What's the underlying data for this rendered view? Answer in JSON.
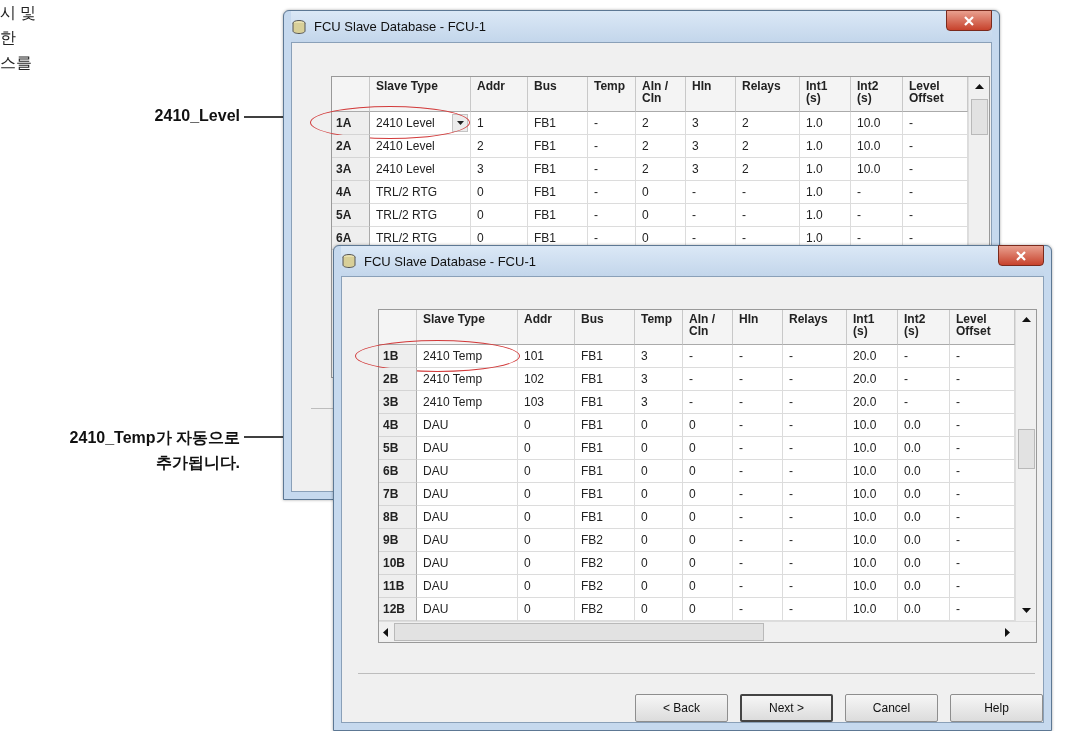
{
  "side_text": {
    "lines": [
      "시 및",
      "한",
      "스를"
    ]
  },
  "callouts": [
    {
      "lines": [
        "2410_Level"
      ]
    },
    {
      "lines": [
        "2410_Temp가 자동으로",
        "추가됩니다."
      ]
    }
  ],
  "windows": [
    {
      "title": "FCU Slave Database - FCU-1",
      "columns": [
        "",
        "Slave Type",
        "Addr",
        "Bus",
        "Temp",
        "AIn /\nCIn",
        "HIn",
        "Relays",
        "Int1\n(s)",
        "Int2\n(s)",
        "Level\nOffset"
      ],
      "rows": [
        {
          "circled": true,
          "dropdown": true,
          "cells": [
            "1A",
            "2410 Level",
            "1",
            "FB1",
            "-",
            "2",
            "3",
            "2",
            "1.0",
            "10.0",
            "-"
          ]
        },
        {
          "circled": false,
          "dropdown": false,
          "cells": [
            "2A",
            "2410 Level",
            "2",
            "FB1",
            "-",
            "2",
            "3",
            "2",
            "1.0",
            "10.0",
            "-"
          ]
        },
        {
          "circled": false,
          "dropdown": false,
          "cells": [
            "3A",
            "2410 Level",
            "3",
            "FB1",
            "-",
            "2",
            "3",
            "2",
            "1.0",
            "10.0",
            "-"
          ]
        },
        {
          "circled": false,
          "dropdown": false,
          "cells": [
            "4A",
            "TRL/2 RTG",
            "0",
            "FB1",
            "-",
            "0",
            "-",
            "-",
            "1.0",
            "-",
            "-"
          ]
        },
        {
          "circled": false,
          "dropdown": false,
          "cells": [
            "5A",
            "TRL/2 RTG",
            "0",
            "FB1",
            "-",
            "0",
            "-",
            "-",
            "1.0",
            "-",
            "-"
          ]
        },
        {
          "circled": false,
          "dropdown": false,
          "cells": [
            "6A",
            "TRL/2 RTG",
            "0",
            "FB1",
            "-",
            "0",
            "-",
            "-",
            "1.0",
            "-",
            "-"
          ]
        }
      ]
    },
    {
      "title": "FCU Slave Database - FCU-1",
      "columns": [
        "",
        "Slave Type",
        "Addr",
        "Bus",
        "Temp",
        "AIn /\nCIn",
        "HIn",
        "Relays",
        "Int1\n(s)",
        "Int2\n(s)",
        "Level\nOffset"
      ],
      "rows": [
        {
          "circled": true,
          "dropdown": false,
          "cells": [
            "1B",
            "2410 Temp",
            "101",
            "FB1",
            "3",
            "-",
            "-",
            "-",
            "20.0",
            "-",
            "-"
          ]
        },
        {
          "circled": false,
          "dropdown": false,
          "cells": [
            "2B",
            "2410 Temp",
            "102",
            "FB1",
            "3",
            "-",
            "-",
            "-",
            "20.0",
            "-",
            "-"
          ]
        },
        {
          "circled": false,
          "dropdown": false,
          "cells": [
            "3B",
            "2410 Temp",
            "103",
            "FB1",
            "3",
            "-",
            "-",
            "-",
            "20.0",
            "-",
            "-"
          ]
        },
        {
          "circled": false,
          "dropdown": false,
          "cells": [
            "4B",
            "DAU",
            "0",
            "FB1",
            "0",
            "0",
            "-",
            "-",
            "10.0",
            "0.0",
            "-"
          ]
        },
        {
          "circled": false,
          "dropdown": false,
          "cells": [
            "5B",
            "DAU",
            "0",
            "FB1",
            "0",
            "0",
            "-",
            "-",
            "10.0",
            "0.0",
            "-"
          ]
        },
        {
          "circled": false,
          "dropdown": false,
          "cells": [
            "6B",
            "DAU",
            "0",
            "FB1",
            "0",
            "0",
            "-",
            "-",
            "10.0",
            "0.0",
            "-"
          ]
        },
        {
          "circled": false,
          "dropdown": false,
          "cells": [
            "7B",
            "DAU",
            "0",
            "FB1",
            "0",
            "0",
            "-",
            "-",
            "10.0",
            "0.0",
            "-"
          ]
        },
        {
          "circled": false,
          "dropdown": false,
          "cells": [
            "8B",
            "DAU",
            "0",
            "FB1",
            "0",
            "0",
            "-",
            "-",
            "10.0",
            "0.0",
            "-"
          ]
        },
        {
          "circled": false,
          "dropdown": false,
          "cells": [
            "9B",
            "DAU",
            "0",
            "FB2",
            "0",
            "0",
            "-",
            "-",
            "10.0",
            "0.0",
            "-"
          ]
        },
        {
          "circled": false,
          "dropdown": false,
          "cells": [
            "10B",
            "DAU",
            "0",
            "FB2",
            "0",
            "0",
            "-",
            "-",
            "10.0",
            "0.0",
            "-"
          ]
        },
        {
          "circled": false,
          "dropdown": false,
          "cells": [
            "11B",
            "DAU",
            "0",
            "FB2",
            "0",
            "0",
            "-",
            "-",
            "10.0",
            "0.0",
            "-"
          ]
        },
        {
          "circled": false,
          "dropdown": false,
          "cells": [
            "12B",
            "DAU",
            "0",
            "FB2",
            "0",
            "0",
            "-",
            "-",
            "10.0",
            "0.0",
            "-"
          ]
        }
      ],
      "buttons": [
        {
          "label": "< Back",
          "default": false
        },
        {
          "label": "Next >",
          "default": true
        },
        {
          "label": "Cancel",
          "default": false
        },
        {
          "label": "Help",
          "default": false
        }
      ]
    }
  ]
}
